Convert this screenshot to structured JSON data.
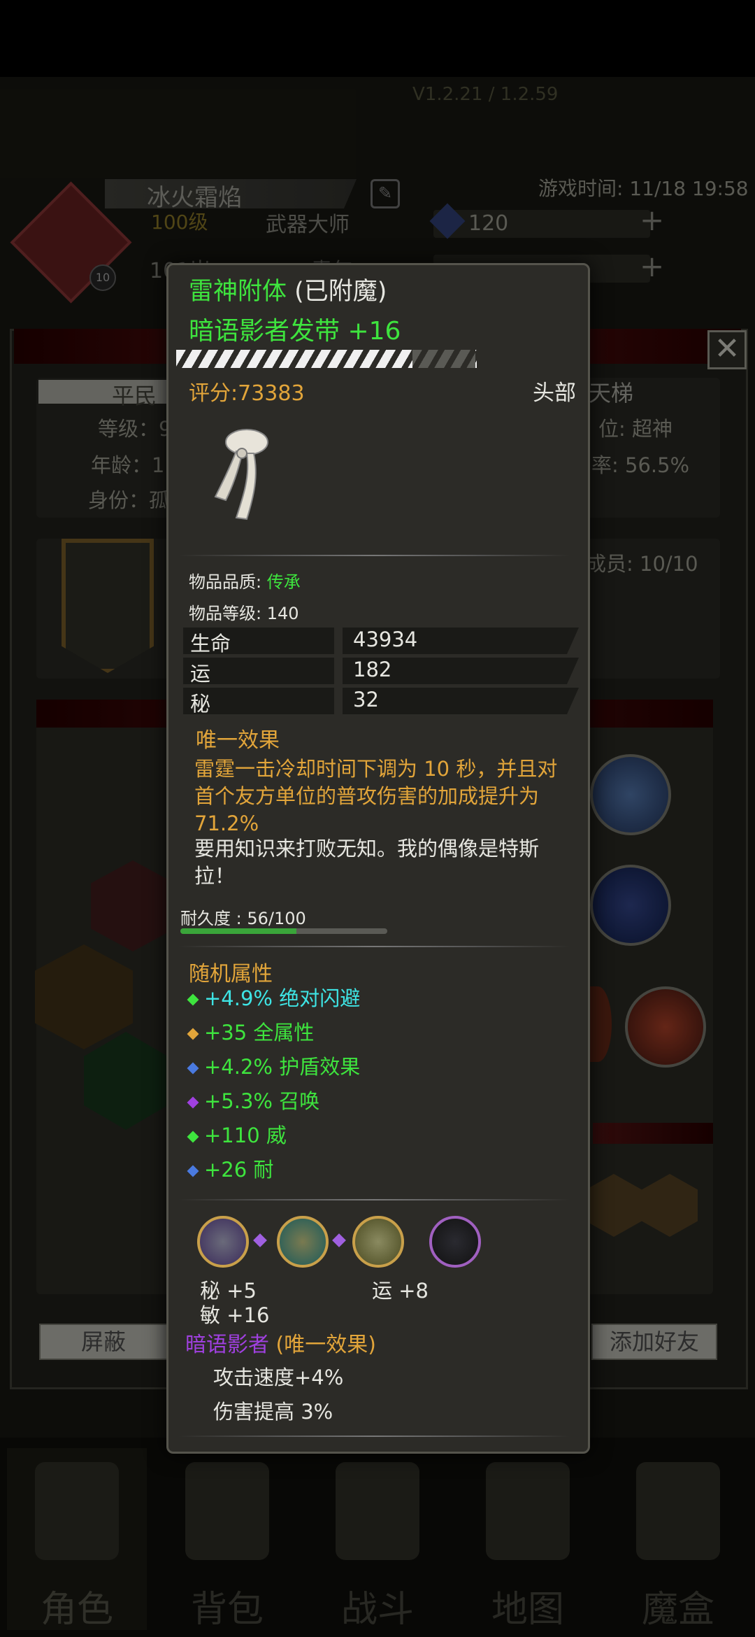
{
  "background": {
    "version": "V1.2.21 / 1.2.59",
    "play_time": "游戏时间: 11/18 19:58",
    "player": {
      "name": "冰火霜焰",
      "level": "100级",
      "title": "武器大师",
      "age_fragment": "101岁",
      "status_fragment": "青年",
      "badge": "10"
    },
    "gems": "120",
    "info": {
      "civ_tab": "平民",
      "ladder": "天梯",
      "level_frag": "等级：9",
      "age_frag": "年龄：1",
      "identity_frag": "身份：孤",
      "rank_frag": "位: 超神",
      "rate_frag": "率: 56.5%",
      "members_frag": "成员: 10/10"
    },
    "buttons": {
      "block": "屏蔽",
      "add_friend": "添加好友"
    },
    "nav": [
      {
        "label": "角色",
        "icon": "helmet-icon"
      },
      {
        "label": "背包",
        "icon": "backpack-icon"
      },
      {
        "label": "战斗",
        "icon": "sword-shield-icon"
      },
      {
        "label": "地图",
        "icon": "scroll-map-icon"
      },
      {
        "label": "魔盒",
        "icon": "magic-box-icon"
      }
    ]
  },
  "tooltip": {
    "enchant_name": "雷神附体",
    "enchant_status": "(已附魔)",
    "item_name": "暗语影者发带 +16",
    "score": "评分:73383",
    "slot": "头部",
    "icon": "headband-icon",
    "quality_label": "物品品质: ",
    "quality_value": "传承",
    "item_level": "物品等级: 140",
    "stats": [
      {
        "name": "生命",
        "value": "43934"
      },
      {
        "name": "运",
        "value": "182"
      },
      {
        "name": "秘",
        "value": "32"
      }
    ],
    "unique_title": "唯一效果",
    "unique_desc": "雷霆一击冷却时间下调为 10 秒，并且对首个友方单位的普攻伤害的加成提升为 71.2%",
    "flavor": "要用知识来打败无知。我的偶像是特斯拉！",
    "durability_label": "耐久度 : 56/100",
    "durability": 0.56,
    "random_title": "随机属性",
    "random_attrs": [
      "+4.9% 绝对闪避",
      "+35 全属性",
      "+4.2% 护盾效果",
      "+5.3% 召唤",
      "+110 威",
      "+26 耐"
    ],
    "sockets": {
      "a": "秘  +5",
      "b": "敏  +16",
      "c": "运  +8"
    },
    "set_name": "暗语影者",
    "set_tag": "(唯一效果)",
    "set_effects": [
      "攻击速度+4%",
      "伤害提高 3%"
    ]
  },
  "colors": {
    "green": "#3ee43e",
    "gold": "#e2a53a",
    "purple": "#a040e0",
    "cyan": "#3ee4e4"
  }
}
